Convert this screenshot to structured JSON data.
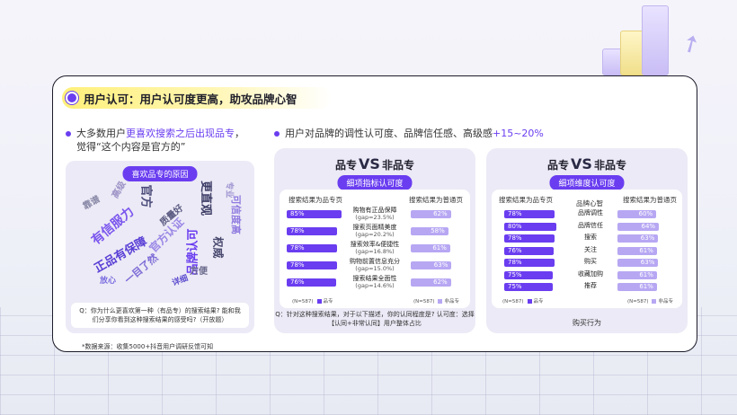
{
  "heading": "用户认可：用户认可度更高，助攻品牌心智",
  "left_bullet": {
    "pre": "大多数用户",
    "highlight": "更喜欢搜索之后出现品专",
    "post": "，",
    "line2": "觉得“这个内容是官方的”"
  },
  "right_bullet": {
    "pre": "用户对品牌的调性认可度、品牌信任感、高级感",
    "highlight": "+15~20%"
  },
  "cloud": {
    "pill": "喜欢品专的原因",
    "question": "Q：你为什么更喜欢第一种（有品专）的搜索结果? 能和我们分享你看到这种搜索结果的感受吗?（开放题）",
    "words": [
      "有信服力",
      "官方",
      "正品有保障",
      "官方认证",
      "更直观",
      "品牌认可",
      "靠谱",
      "一目了然",
      "权威",
      "高级",
      "方便",
      "可信度高",
      "质量好",
      "放心",
      "专业",
      "详细"
    ]
  },
  "panel1": {
    "title_left": "品专",
    "vs": "VS",
    "title_right": "非品专",
    "sub_pill": "细项指标认可度",
    "col_left": "搜索结果为品专页",
    "col_right": "搜索结果为普通页",
    "rows": [
      {
        "left": "85%",
        "left_v": 85,
        "label": "购物有正品保障",
        "gap": "(gap=23.5%)",
        "right": "62%",
        "right_v": 62
      },
      {
        "left": "78%",
        "left_v": 78,
        "label": "搜索页面精美度",
        "gap": "(gap=20.2%)",
        "right": "58%",
        "right_v": 58
      },
      {
        "left": "78%",
        "left_v": 78,
        "label": "搜索效率&便捷性",
        "gap": "(gap=16.8%)",
        "right": "61%",
        "right_v": 61
      },
      {
        "left": "78%",
        "left_v": 78,
        "label": "购物前置信息充分",
        "gap": "(gap=15.0%)",
        "right": "63%",
        "right_v": 63
      },
      {
        "left": "76%",
        "left_v": 76,
        "label": "搜索结果全面性",
        "gap": "(gap=14.6%)",
        "right": "62%",
        "right_v": 62
      }
    ],
    "legend_left_n": "(N=587)",
    "legend_left": "品专",
    "legend_right_n": "(N=587)",
    "legend_right": "非品专",
    "footer": "Q：针对这种搜索结果，对于以下描述，你的认同程度是? 认可度：选择【认同+非常认同】用户整体占比"
  },
  "panel2": {
    "title_left": "品专",
    "vs": "VS",
    "title_right": "非品专",
    "sub_pill": "细项维度认可度",
    "col_left": "搜索结果为品专页",
    "col_mid": "品牌心智",
    "col_right": "搜索结果为普通页",
    "rows": [
      {
        "left": "78%",
        "left_v": 78,
        "label": "品牌调性",
        "right": "60%",
        "right_v": 60
      },
      {
        "left": "80%",
        "left_v": 80,
        "label": "品牌信任",
        "right": "64%",
        "right_v": 64
      },
      {
        "left": "78%",
        "left_v": 78,
        "label": "搜索",
        "right": "63%",
        "right_v": 63
      },
      {
        "left": "76%",
        "left_v": 76,
        "label": "关注",
        "right": "61%",
        "right_v": 61
      },
      {
        "left": "78%",
        "left_v": 78,
        "label": "购买",
        "right": "63%",
        "right_v": 63
      },
      {
        "left": "75%",
        "left_v": 75,
        "label": "收藏加购",
        "right": "61%",
        "right_v": 61
      },
      {
        "left": "75%",
        "left_v": 75,
        "label": "推荐",
        "right": "61%",
        "right_v": 61
      }
    ],
    "bottom_label": "购买行为",
    "legend_left_n": "(N=587)",
    "legend_left": "品专",
    "legend_right_n": "(N=587)",
    "legend_right": "非品专"
  },
  "source": "*数据来源：收集5000+抖音用户调研反馈可知",
  "colors": {
    "accent": "#6a3df0",
    "accent_light": "#b7a7f3",
    "highlight": "#fff07a"
  }
}
